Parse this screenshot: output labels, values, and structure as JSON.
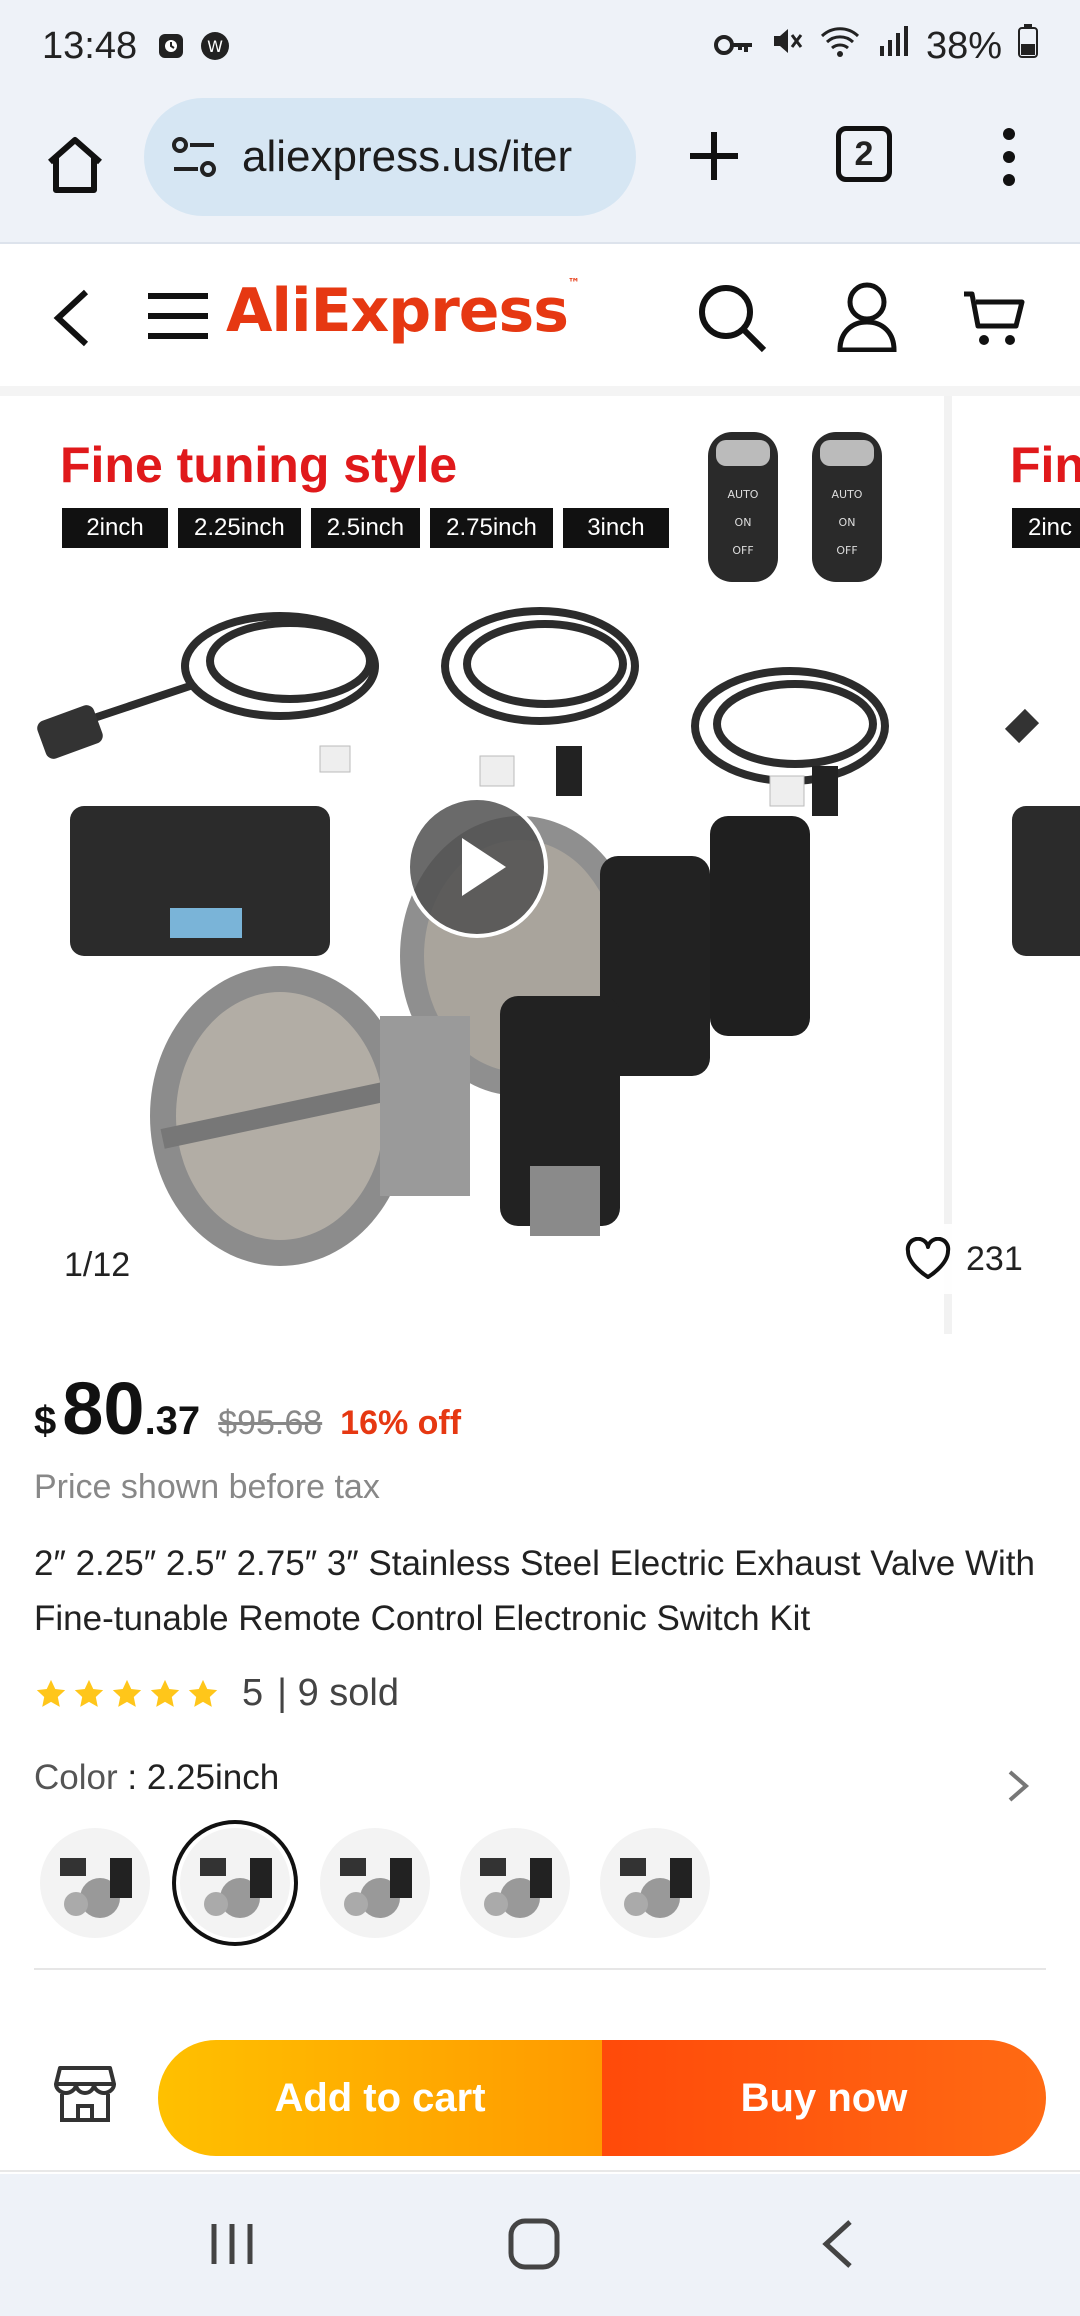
{
  "status_bar": {
    "time": "13:48",
    "battery": "38%",
    "icons": [
      "alarm-icon",
      "app-notification-icon",
      "key-icon",
      "mute-icon",
      "wifi-icon",
      "signal-icon",
      "battery-icon"
    ]
  },
  "browser": {
    "url": "aliexpress.us/iter",
    "tab_count": "2"
  },
  "header": {
    "logo": "AliExpress",
    "icons": [
      "back-icon",
      "menu-icon",
      "search-icon",
      "account-icon",
      "cart-icon"
    ]
  },
  "gallery": {
    "image_title": "Fine tuning style",
    "sizes": [
      "2inch",
      "2.25inch",
      "2.5inch",
      "2.75inch",
      "3inch"
    ],
    "counter": "1/12",
    "likes": "231",
    "next_title": "Fin",
    "next_size": "2inc",
    "remote_buttons": [
      "AUTO",
      "ON",
      "OFF"
    ]
  },
  "product": {
    "currency": "$",
    "price_int": "80",
    "price_dec": ".37",
    "price_old": "$95.68",
    "discount": "16% off",
    "tax_note": "Price shown before tax",
    "title": "2″ 2.25″ 2.5″ 2.75″ 3″ Stainless Steel Electric Exhaust Valve With Fine-tunable Remote Control Electronic Switch Kit",
    "rating": 5,
    "rating_text": "5",
    "sold_text": "| 9 sold",
    "color_key": "Color",
    "color_value": "2.25inch",
    "color_options_selected": 1
  },
  "actions": {
    "add_to_cart": "Add to cart",
    "buy_now": "Buy now"
  },
  "colors": {
    "brand": "#e63812",
    "star": "#ffc61a",
    "add_to_cart_start": "#ffc000",
    "buy_now": "#ff4a0a"
  }
}
